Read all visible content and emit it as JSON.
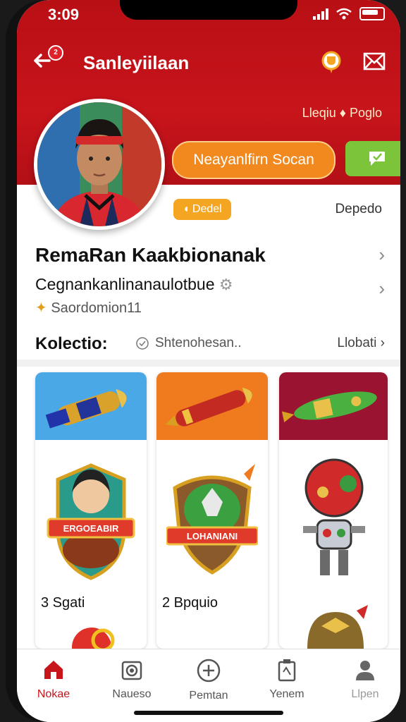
{
  "status": {
    "time": "3:09"
  },
  "header": {
    "title": "Sanleyiilaan",
    "notification_count": "2"
  },
  "hero": {
    "meta_link": "Lleqiu ♦ Poglo",
    "primary_button": "Neayanlfirn Socan"
  },
  "profile": {
    "badge": "Dedel",
    "right_label": "Depedo",
    "name": "RemaRan Kaakbionanak",
    "subtitle": "Cegnankanlinanaulotbue",
    "tag": "Saordomion11"
  },
  "collection": {
    "title": "Kolectio:",
    "search_placeholder": "Shtenohesan..",
    "more_label": "Llobati"
  },
  "cards": [
    {
      "count": "3 Sgati",
      "top_color": "#4aa8e6",
      "shield_text": "ERGOEABIR"
    },
    {
      "count": "2 Bpquio",
      "top_color": "#f07a1e",
      "shield_text": "LOHANIANI"
    },
    {
      "count": "",
      "top_color": "#9a1330",
      "shield_text": ""
    }
  ],
  "tabbar": {
    "items": [
      {
        "label": "Nokae",
        "icon": "home-icon"
      },
      {
        "label": "Naueso",
        "icon": "camera-icon"
      },
      {
        "label": "Pemtan",
        "icon": "plus-circle-icon"
      },
      {
        "label": "Yenem",
        "icon": "clipboard-icon"
      },
      {
        "label": "Llpen",
        "icon": "person-icon"
      }
    ]
  },
  "colors": {
    "brand_red": "#c8141b",
    "accent_orange": "#f2891e",
    "accent_green": "#7cc43a"
  }
}
